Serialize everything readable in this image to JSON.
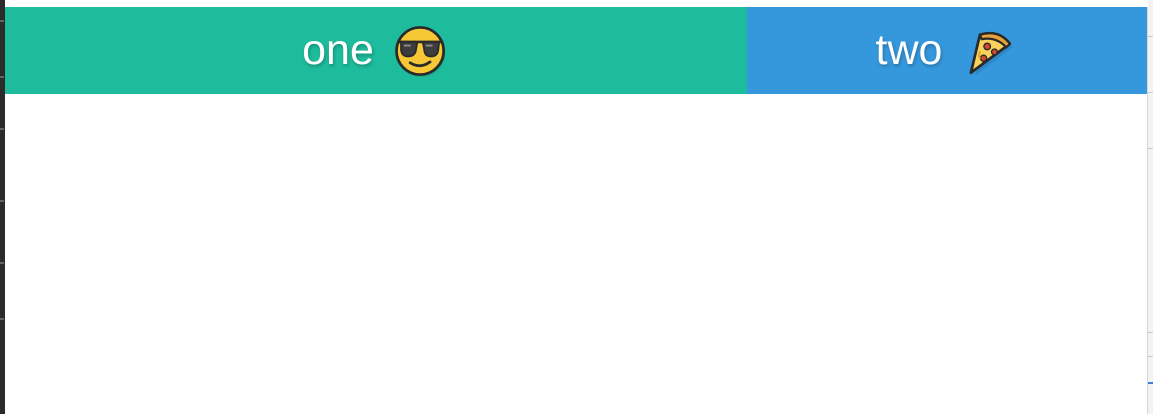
{
  "tabs": [
    {
      "label": "one",
      "icon": "sunglasses-face-icon",
      "color": "#1dbc9c"
    },
    {
      "label": "two",
      "icon": "pizza-slice-icon",
      "color": "#3598dc"
    }
  ],
  "content": {
    "text": ""
  }
}
